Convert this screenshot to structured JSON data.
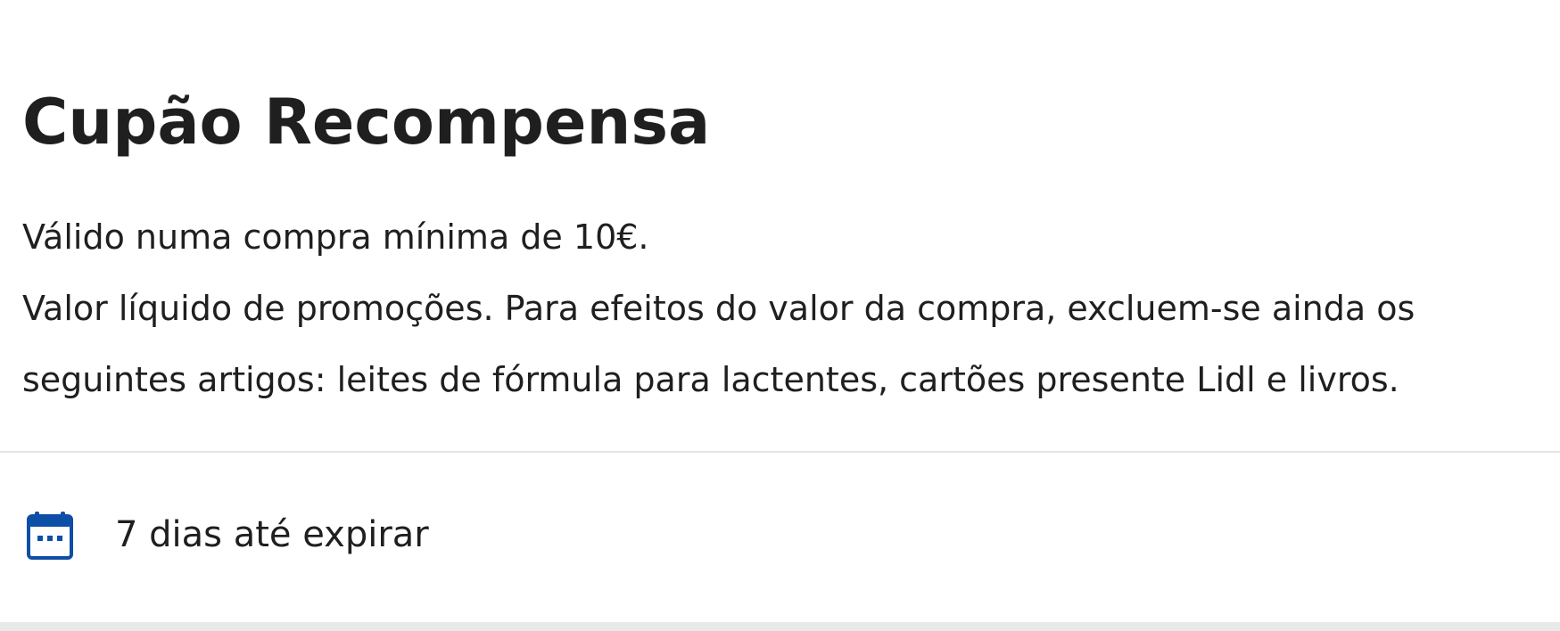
{
  "coupon": {
    "title": "Cupão Recompensa",
    "description_lines": [
      "Válido numa compra mínima de 10€.",
      "Valor líquido de promoções. Para efeitos do valor da compra, excluem-se ainda os",
      "seguintes artigos: leites de fórmula para lactentes, cartões presente Lidl e livros."
    ],
    "expiry": {
      "icon": "calendar-icon",
      "text": "7 dias até expirar"
    }
  },
  "colors": {
    "text": "#1f1f1f",
    "icon_blue": "#0d4ea6",
    "divider": "#e4e4e4",
    "background": "#ffffff"
  }
}
